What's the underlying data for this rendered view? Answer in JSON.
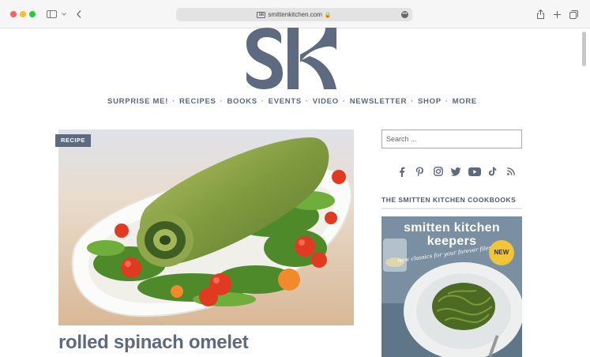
{
  "browser": {
    "url": "smittenkitchen.com",
    "favicon_text": "sk"
  },
  "site": {
    "logo_text": "sk"
  },
  "nav": {
    "items": [
      "SURPRISE ME!",
      "RECIPES",
      "BOOKS",
      "EVENTS",
      "VIDEO",
      "NEWSLETTER",
      "SHOP",
      "MORE"
    ]
  },
  "post": {
    "category_badge": "RECIPE",
    "title": "rolled spinach omelet"
  },
  "sidebar": {
    "search_placeholder": "Search ...",
    "social_icons": [
      "facebook-icon",
      "pinterest-icon",
      "instagram-icon",
      "twitter-icon",
      "youtube-icon",
      "tiktok-icon",
      "rss-icon"
    ],
    "cookbooks_heading": "THE SMITTEN KITCHEN COOKBOOKS",
    "book": {
      "title_line1": "smitten kitchen",
      "title_line2": "keepers",
      "subtitle": "new classics for your forever files",
      "new_badge": "NEW"
    }
  },
  "colors": {
    "brand": "#5d6a80",
    "nav_text": "#5a6780"
  }
}
